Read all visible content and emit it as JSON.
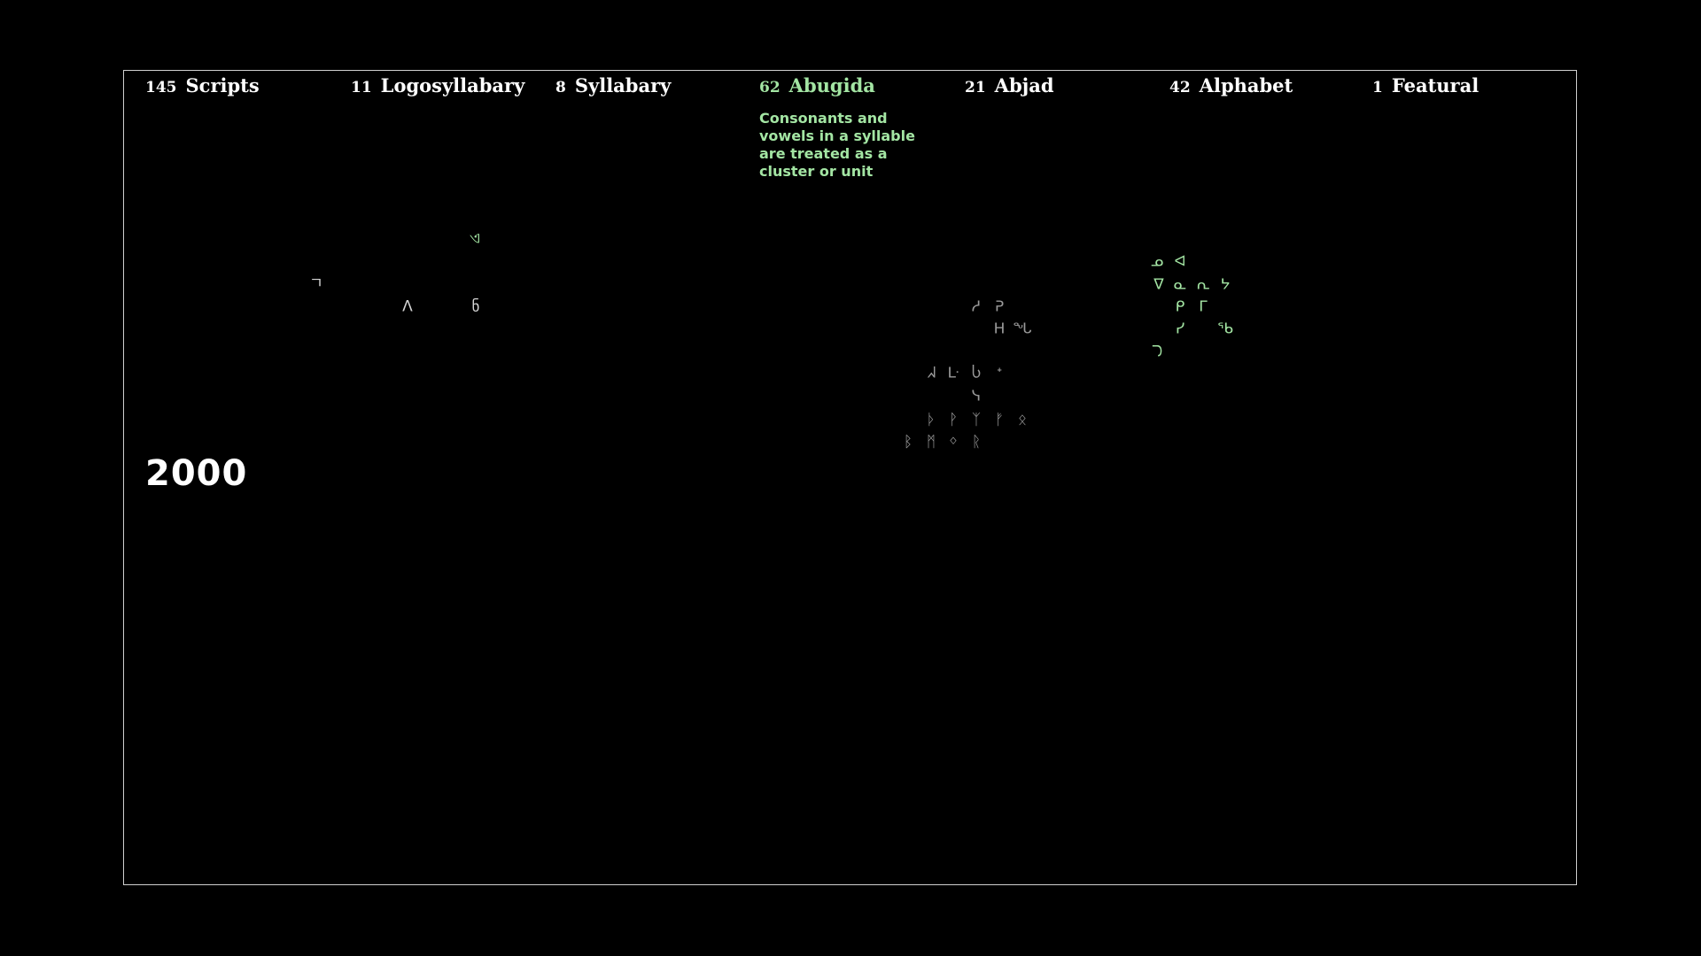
{
  "header": {
    "total": {
      "count": "145",
      "label": "Scripts"
    },
    "categories": [
      {
        "count": "11",
        "label": "Logosyllabary"
      },
      {
        "count": "8",
        "label": "Syllabary"
      },
      {
        "count": "62",
        "label": "Abugida"
      },
      {
        "count": "21",
        "label": "Abjad"
      },
      {
        "count": "42",
        "label": "Alphabet"
      },
      {
        "count": "1",
        "label": "Featural"
      }
    ],
    "active_category_index": 2
  },
  "description": "Consonants and vowels in a syllable are treated as a cluster or unit",
  "year": "2000",
  "colors": {
    "background": "#000000",
    "frame": "#cfcfcf",
    "text": "#ffffff",
    "highlight": "#a3e5a3",
    "dim": "#9a9a9a",
    "light": "#d6d6d6"
  },
  "glyphs": [
    {
      "char": "ᓄ",
      "c": "hi"
    },
    {
      "char": "ᐊ",
      "c": "hi"
    },
    {
      "char": "ᐁ",
      "c": "hi"
    },
    {
      "char": "ᓇ",
      "c": "hi"
    },
    {
      "char": "ᕆ",
      "c": "hi"
    },
    {
      "char": "ᔭ",
      "c": "hi"
    },
    {
      "char": "ᑭ",
      "c": "hi"
    },
    {
      "char": "ᒥ",
      "c": "hi"
    },
    {
      "char": "ᓯ",
      "c": "hi"
    },
    {
      "char": "ᖃ",
      "c": "hi"
    },
    {
      "char": "ᘄ",
      "c": "hi"
    },
    {
      "char": "ᓱ",
      "c": "dim"
    },
    {
      "char": "ᕈ",
      "c": "dim"
    },
    {
      "char": "ᕼ",
      "c": "dim"
    },
    {
      "char": "ᖓ",
      "c": "dim"
    },
    {
      "char": "ᖽ",
      "c": "dim"
    },
    {
      "char": "ᒷ",
      "c": "dim"
    },
    {
      "char": "Ⴑ",
      "c": "dim"
    },
    {
      "char": "ᐩ",
      "c": "dim"
    },
    {
      "char": "ᓭ",
      "c": "dim"
    },
    {
      "char": "ᚦ",
      "c": "dim"
    },
    {
      "char": "ᚹ",
      "c": "dim"
    },
    {
      "char": "ᛉ",
      "c": "dim"
    },
    {
      "char": "ᚠ",
      "c": "dim"
    },
    {
      "char": "ᛟ",
      "c": "dim"
    },
    {
      "char": "ᛒ",
      "c": "dim"
    },
    {
      "char": "ᛗ",
      "c": "dim"
    },
    {
      "char": "ᛜ",
      "c": "dim"
    },
    {
      "char": "ᚱ",
      "c": "dim"
    },
    {
      "char": "ㄱ",
      "c": "light"
    },
    {
      "char": "Λ",
      "c": "light"
    },
    {
      "char": "ნ",
      "c": "light"
    },
    {
      "char": "ଏ",
      "c": "hi"
    }
  ]
}
